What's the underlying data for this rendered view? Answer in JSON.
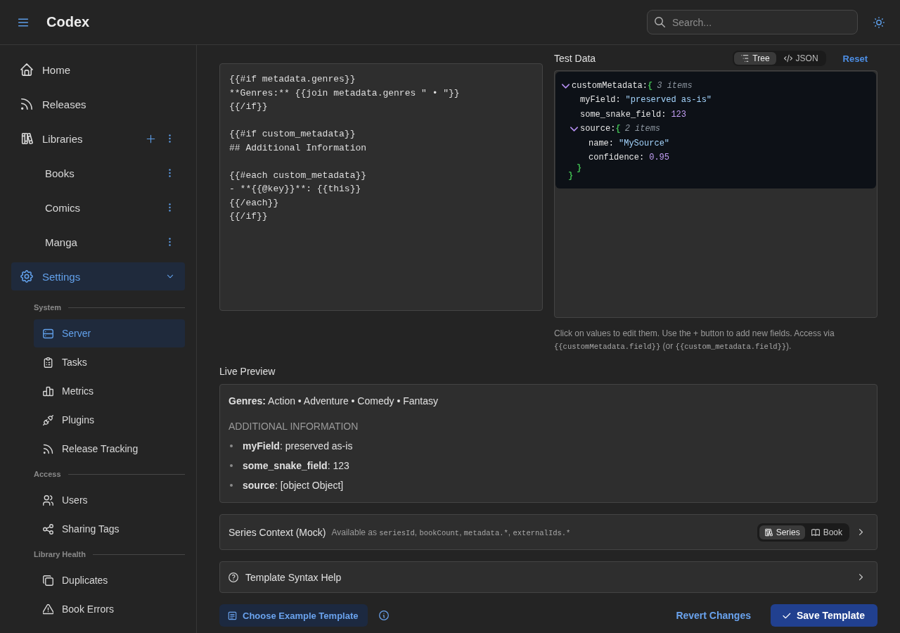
{
  "header": {
    "title": "Codex",
    "search": {
      "placeholder": "Search..."
    }
  },
  "sidebar": {
    "items": [
      {
        "label": "Home",
        "selected": false
      },
      {
        "label": "Releases",
        "selected": false
      },
      {
        "label": "Libraries",
        "selected": false,
        "children": [
          {
            "label": "Books",
            "selected": false
          },
          {
            "label": "Comics",
            "selected": false
          },
          {
            "label": "Manga",
            "selected": false
          }
        ]
      },
      {
        "label": "Settings",
        "selected": true,
        "expanded": true,
        "sections": [
          {
            "title": "System",
            "items": [
              {
                "label": "Server",
                "selected": true
              },
              {
                "label": "Tasks",
                "selected": false
              },
              {
                "label": "Metrics",
                "selected": false
              },
              {
                "label": "Plugins",
                "selected": false
              },
              {
                "label": "Release Tracking",
                "selected": false
              }
            ]
          },
          {
            "title": "Access",
            "items": [
              {
                "label": "Users",
                "selected": false
              },
              {
                "label": "Sharing Tags",
                "selected": false
              }
            ]
          },
          {
            "title": "Library Health",
            "items": [
              {
                "label": "Duplicates",
                "selected": false
              },
              {
                "label": "Book Errors",
                "selected": false
              }
            ]
          }
        ]
      }
    ]
  },
  "template_editor": {
    "value": "{{#if metadata.genres}}\n**Genres:** {{join metadata.genres \" • \"}}\n{{/if}}\n\n{{#if custom_metadata}}\n## Additional Information\n\n{{#each custom_metadata}}\n- **{{@key}}**: {{this}}\n{{/each}}\n{{/if}}"
  },
  "test_data": {
    "label": "Test Data",
    "views": [
      {
        "label": "Tree",
        "selected": true
      },
      {
        "label": "JSON",
        "selected": false
      }
    ],
    "reset": "Reset",
    "tree": {
      "key": "customMetadata:",
      "kind": "object",
      "expanded": true,
      "open": "{",
      "summary": "3 items",
      "close": "}",
      "children": [
        {
          "key": "myField:",
          "kind": "string",
          "value": "\"preserved as-is\""
        },
        {
          "key": "some_snake_field:",
          "kind": "number",
          "value": "123"
        },
        {
          "key": "source:",
          "kind": "object",
          "expanded": true,
          "open": "{",
          "summary": "2 items",
          "close": "}",
          "children": [
            {
              "key": "name:",
              "kind": "string",
              "value": "\"MySource\""
            },
            {
              "key": "confidence:",
              "kind": "number",
              "value": "0.95"
            }
          ]
        }
      ]
    },
    "help": [
      {
        "kind": "text",
        "text": "Click on values to edit them. Use the + button to add new fields. Access via "
      },
      {
        "kind": "code",
        "text": "{{customMetadata.field}}"
      },
      {
        "kind": "text",
        "text": " (or "
      },
      {
        "kind": "code",
        "text": "{{custom_metadata.field}}"
      },
      {
        "kind": "text",
        "text": ")."
      }
    ]
  },
  "live_preview": {
    "label": "Live Preview",
    "genres": "**Genres:** Action • Adventure • Comedy • Fantasy",
    "heading": "ADDITIONAL INFORMATION",
    "items": [
      "**myField**: preserved as-is",
      "**some_snake_field**: 123",
      "**source**: [object Object]"
    ]
  },
  "series_context": {
    "title": "Series Context (Mock)",
    "hint": [
      {
        "kind": "text",
        "text": "Available as "
      },
      {
        "kind": "code",
        "text": "seriesId"
      },
      {
        "kind": "text",
        "text": ", "
      },
      {
        "kind": "code",
        "text": "bookCount"
      },
      {
        "kind": "text",
        "text": ", "
      },
      {
        "kind": "code",
        "text": "metadata.*"
      },
      {
        "kind": "text",
        "text": ", "
      },
      {
        "kind": "code",
        "text": "externalIds.*"
      }
    ],
    "modes": [
      {
        "label": "Series",
        "selected": true
      },
      {
        "label": "Book",
        "selected": false
      }
    ],
    "expanded": false
  },
  "syntax_help": {
    "title": "Template Syntax Help",
    "expanded": false
  },
  "actions": {
    "example": "Choose Example Template",
    "revert": "Revert Changes",
    "save": "Save Template"
  }
}
